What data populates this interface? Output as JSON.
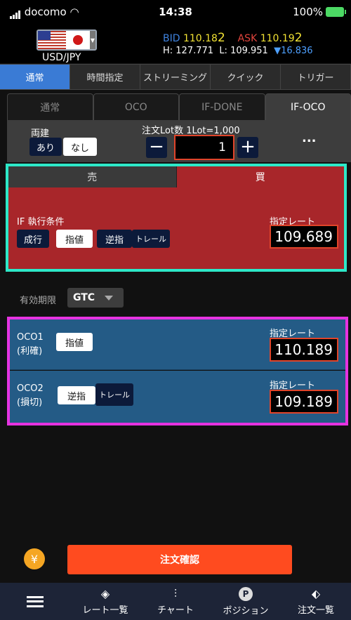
{
  "status": {
    "carrier": "docomo",
    "time": "14:38",
    "battery": "100%"
  },
  "header": {
    "pair": "USD/JPY",
    "bid_label": "BID",
    "bid_main": "110.18",
    "bid_last": "2",
    "ask_label": "ASK",
    "ask_main": "110.19",
    "ask_last": "2",
    "high": "H: 127.771",
    "low": "L: 109.951",
    "change": "▼16.836"
  },
  "order_types": [
    "通常",
    "時間指定",
    "ストリーミング",
    "クイック",
    "トリガー"
  ],
  "sub_tabs": [
    "通常",
    "OCO",
    "IF-DONE",
    "IF-OCO"
  ],
  "lot": {
    "ryodate_label": "両建",
    "ari": "あり",
    "nashi": "なし",
    "lot_label": "注文Lot数 1Lot=1,000",
    "minus": "−",
    "plus": "+",
    "value": "1",
    "more": "..."
  },
  "side": {
    "sell": "売",
    "buy": "買"
  },
  "if_panel": {
    "condition_label": "IF 執行条件",
    "buttons": [
      "成行",
      "指値",
      "逆指",
      "トレール"
    ],
    "rate_label": "指定レート",
    "rate": "109.689"
  },
  "expiry": {
    "label": "有効期限",
    "value": "GTC"
  },
  "oco1": {
    "label1": "OCO1",
    "label2": "(利確)",
    "button": "指値",
    "rate_label": "指定レート",
    "rate": "110.189"
  },
  "oco2": {
    "label1": "OCO2",
    "label2": "(損切)",
    "btn1": "逆指",
    "btn2": "トレール",
    "rate_label": "指定レート",
    "rate": "109.189"
  },
  "confirm": {
    "yen": "¥",
    "label": "注文確認"
  },
  "nav": {
    "rates": "レート一覧",
    "chart": "チャート",
    "position": "ポジション",
    "position_icon": "P",
    "orders": "注文一覧"
  },
  "colors": {
    "accent_blue": "#3a7bd5",
    "buy_red": "#a8262a",
    "oco_blue": "#245b86",
    "confirm_orange": "#ff4b1f",
    "cyan_highlight": "#2de8c8",
    "magenta_highlight": "#e633e0"
  }
}
